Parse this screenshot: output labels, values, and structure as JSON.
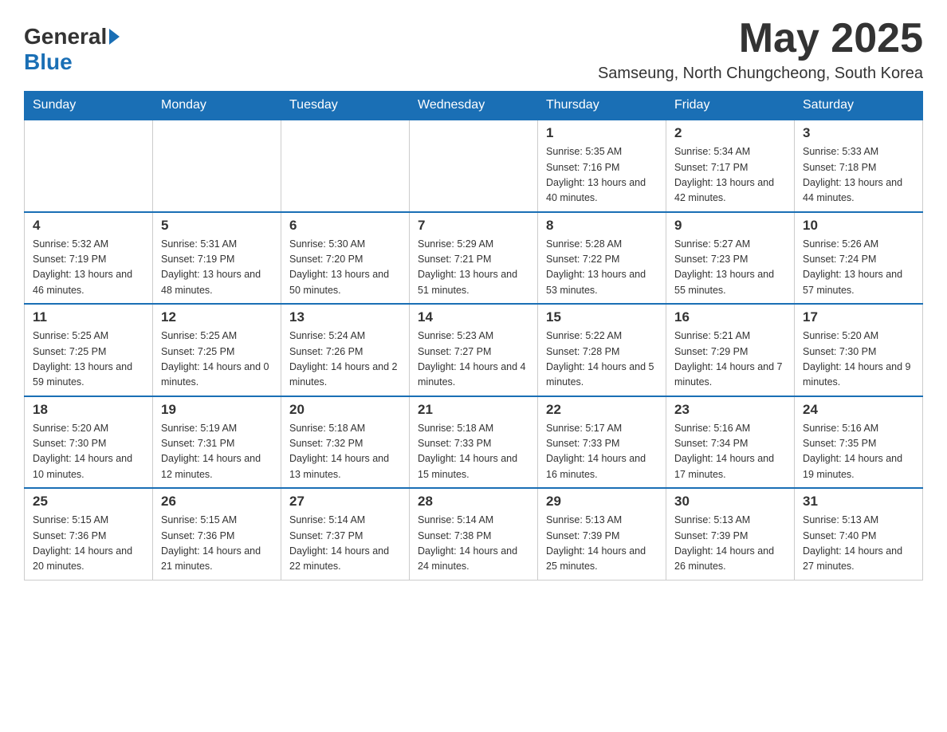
{
  "logo": {
    "general": "General",
    "blue": "Blue"
  },
  "header": {
    "title": "May 2025",
    "subtitle": "Samseung, North Chungcheong, South Korea"
  },
  "days_of_week": [
    "Sunday",
    "Monday",
    "Tuesday",
    "Wednesday",
    "Thursday",
    "Friday",
    "Saturday"
  ],
  "weeks": [
    [
      {
        "day": "",
        "sunrise": "",
        "sunset": "",
        "daylight": ""
      },
      {
        "day": "",
        "sunrise": "",
        "sunset": "",
        "daylight": ""
      },
      {
        "day": "",
        "sunrise": "",
        "sunset": "",
        "daylight": ""
      },
      {
        "day": "",
        "sunrise": "",
        "sunset": "",
        "daylight": ""
      },
      {
        "day": "1",
        "sunrise": "Sunrise: 5:35 AM",
        "sunset": "Sunset: 7:16 PM",
        "daylight": "Daylight: 13 hours and 40 minutes."
      },
      {
        "day": "2",
        "sunrise": "Sunrise: 5:34 AM",
        "sunset": "Sunset: 7:17 PM",
        "daylight": "Daylight: 13 hours and 42 minutes."
      },
      {
        "day": "3",
        "sunrise": "Sunrise: 5:33 AM",
        "sunset": "Sunset: 7:18 PM",
        "daylight": "Daylight: 13 hours and 44 minutes."
      }
    ],
    [
      {
        "day": "4",
        "sunrise": "Sunrise: 5:32 AM",
        "sunset": "Sunset: 7:19 PM",
        "daylight": "Daylight: 13 hours and 46 minutes."
      },
      {
        "day": "5",
        "sunrise": "Sunrise: 5:31 AM",
        "sunset": "Sunset: 7:19 PM",
        "daylight": "Daylight: 13 hours and 48 minutes."
      },
      {
        "day": "6",
        "sunrise": "Sunrise: 5:30 AM",
        "sunset": "Sunset: 7:20 PM",
        "daylight": "Daylight: 13 hours and 50 minutes."
      },
      {
        "day": "7",
        "sunrise": "Sunrise: 5:29 AM",
        "sunset": "Sunset: 7:21 PM",
        "daylight": "Daylight: 13 hours and 51 minutes."
      },
      {
        "day": "8",
        "sunrise": "Sunrise: 5:28 AM",
        "sunset": "Sunset: 7:22 PM",
        "daylight": "Daylight: 13 hours and 53 minutes."
      },
      {
        "day": "9",
        "sunrise": "Sunrise: 5:27 AM",
        "sunset": "Sunset: 7:23 PM",
        "daylight": "Daylight: 13 hours and 55 minutes."
      },
      {
        "day": "10",
        "sunrise": "Sunrise: 5:26 AM",
        "sunset": "Sunset: 7:24 PM",
        "daylight": "Daylight: 13 hours and 57 minutes."
      }
    ],
    [
      {
        "day": "11",
        "sunrise": "Sunrise: 5:25 AM",
        "sunset": "Sunset: 7:25 PM",
        "daylight": "Daylight: 13 hours and 59 minutes."
      },
      {
        "day": "12",
        "sunrise": "Sunrise: 5:25 AM",
        "sunset": "Sunset: 7:25 PM",
        "daylight": "Daylight: 14 hours and 0 minutes."
      },
      {
        "day": "13",
        "sunrise": "Sunrise: 5:24 AM",
        "sunset": "Sunset: 7:26 PM",
        "daylight": "Daylight: 14 hours and 2 minutes."
      },
      {
        "day": "14",
        "sunrise": "Sunrise: 5:23 AM",
        "sunset": "Sunset: 7:27 PM",
        "daylight": "Daylight: 14 hours and 4 minutes."
      },
      {
        "day": "15",
        "sunrise": "Sunrise: 5:22 AM",
        "sunset": "Sunset: 7:28 PM",
        "daylight": "Daylight: 14 hours and 5 minutes."
      },
      {
        "day": "16",
        "sunrise": "Sunrise: 5:21 AM",
        "sunset": "Sunset: 7:29 PM",
        "daylight": "Daylight: 14 hours and 7 minutes."
      },
      {
        "day": "17",
        "sunrise": "Sunrise: 5:20 AM",
        "sunset": "Sunset: 7:30 PM",
        "daylight": "Daylight: 14 hours and 9 minutes."
      }
    ],
    [
      {
        "day": "18",
        "sunrise": "Sunrise: 5:20 AM",
        "sunset": "Sunset: 7:30 PM",
        "daylight": "Daylight: 14 hours and 10 minutes."
      },
      {
        "day": "19",
        "sunrise": "Sunrise: 5:19 AM",
        "sunset": "Sunset: 7:31 PM",
        "daylight": "Daylight: 14 hours and 12 minutes."
      },
      {
        "day": "20",
        "sunrise": "Sunrise: 5:18 AM",
        "sunset": "Sunset: 7:32 PM",
        "daylight": "Daylight: 14 hours and 13 minutes."
      },
      {
        "day": "21",
        "sunrise": "Sunrise: 5:18 AM",
        "sunset": "Sunset: 7:33 PM",
        "daylight": "Daylight: 14 hours and 15 minutes."
      },
      {
        "day": "22",
        "sunrise": "Sunrise: 5:17 AM",
        "sunset": "Sunset: 7:33 PM",
        "daylight": "Daylight: 14 hours and 16 minutes."
      },
      {
        "day": "23",
        "sunrise": "Sunrise: 5:16 AM",
        "sunset": "Sunset: 7:34 PM",
        "daylight": "Daylight: 14 hours and 17 minutes."
      },
      {
        "day": "24",
        "sunrise": "Sunrise: 5:16 AM",
        "sunset": "Sunset: 7:35 PM",
        "daylight": "Daylight: 14 hours and 19 minutes."
      }
    ],
    [
      {
        "day": "25",
        "sunrise": "Sunrise: 5:15 AM",
        "sunset": "Sunset: 7:36 PM",
        "daylight": "Daylight: 14 hours and 20 minutes."
      },
      {
        "day": "26",
        "sunrise": "Sunrise: 5:15 AM",
        "sunset": "Sunset: 7:36 PM",
        "daylight": "Daylight: 14 hours and 21 minutes."
      },
      {
        "day": "27",
        "sunrise": "Sunrise: 5:14 AM",
        "sunset": "Sunset: 7:37 PM",
        "daylight": "Daylight: 14 hours and 22 minutes."
      },
      {
        "day": "28",
        "sunrise": "Sunrise: 5:14 AM",
        "sunset": "Sunset: 7:38 PM",
        "daylight": "Daylight: 14 hours and 24 minutes."
      },
      {
        "day": "29",
        "sunrise": "Sunrise: 5:13 AM",
        "sunset": "Sunset: 7:39 PM",
        "daylight": "Daylight: 14 hours and 25 minutes."
      },
      {
        "day": "30",
        "sunrise": "Sunrise: 5:13 AM",
        "sunset": "Sunset: 7:39 PM",
        "daylight": "Daylight: 14 hours and 26 minutes."
      },
      {
        "day": "31",
        "sunrise": "Sunrise: 5:13 AM",
        "sunset": "Sunset: 7:40 PM",
        "daylight": "Daylight: 14 hours and 27 minutes."
      }
    ]
  ]
}
